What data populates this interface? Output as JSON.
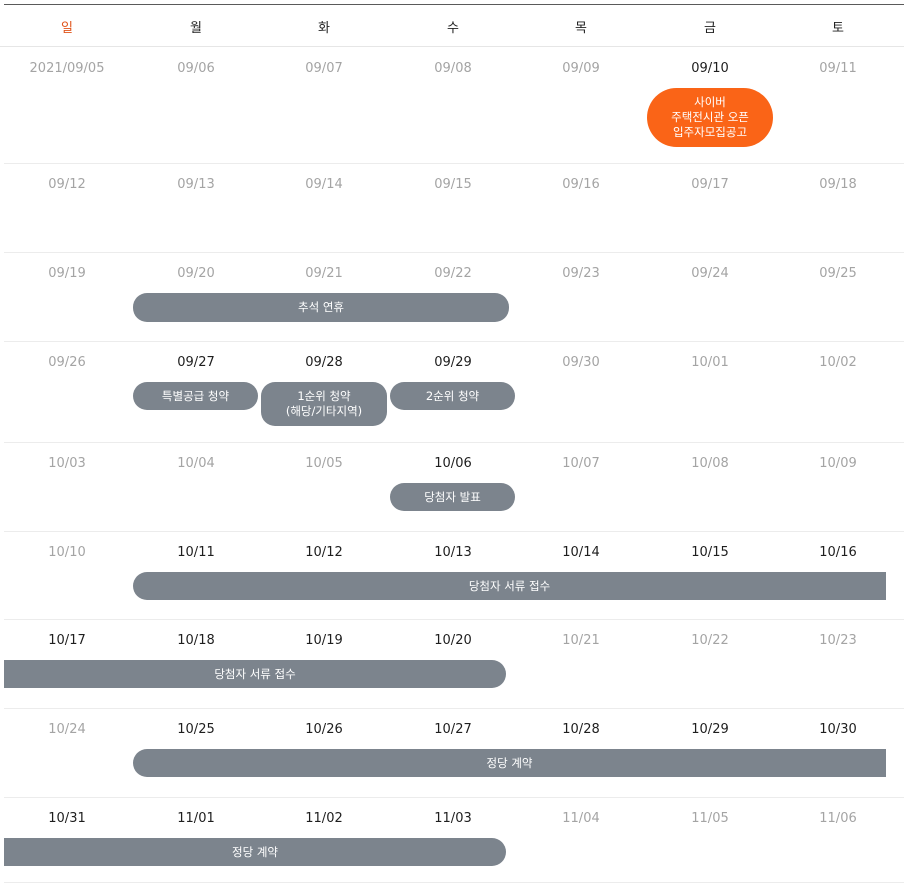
{
  "calendar": {
    "weekdays": [
      "일",
      "월",
      "화",
      "수",
      "목",
      "금",
      "토"
    ],
    "weeks": [
      {
        "dates": [
          "2021/09/05",
          "09/06",
          "09/07",
          "09/08",
          "09/09",
          "09/10",
          "09/11"
        ],
        "active": [
          false,
          false,
          false,
          false,
          false,
          true,
          false
        ],
        "events": [
          {
            "label": "사이버\n주택전시관 오픈\n입주자모집공고",
            "color": "orange"
          }
        ]
      },
      {
        "dates": [
          "09/12",
          "09/13",
          "09/14",
          "09/15",
          "09/16",
          "09/17",
          "09/18"
        ],
        "active": [
          false,
          false,
          false,
          false,
          false,
          false,
          false
        ],
        "events": []
      },
      {
        "dates": [
          "09/19",
          "09/20",
          "09/21",
          "09/22",
          "09/23",
          "09/24",
          "09/25"
        ],
        "active": [
          false,
          false,
          false,
          false,
          false,
          false,
          false
        ],
        "events": [
          {
            "label": "추석 연휴"
          }
        ]
      },
      {
        "dates": [
          "09/26",
          "09/27",
          "09/28",
          "09/29",
          "09/30",
          "10/01",
          "10/02"
        ],
        "active": [
          false,
          true,
          true,
          true,
          false,
          false,
          false
        ],
        "events": [
          {
            "label": "특별공급 청약"
          },
          {
            "label": "1순위 청약\n(해당/기타지역)"
          },
          {
            "label": "2순위 청약"
          }
        ]
      },
      {
        "dates": [
          "10/03",
          "10/04",
          "10/05",
          "10/06",
          "10/07",
          "10/08",
          "10/09"
        ],
        "active": [
          false,
          false,
          false,
          true,
          false,
          false,
          false
        ],
        "events": [
          {
            "label": "당첨자 발표"
          }
        ]
      },
      {
        "dates": [
          "10/10",
          "10/11",
          "10/12",
          "10/13",
          "10/14",
          "10/15",
          "10/16"
        ],
        "active": [
          false,
          true,
          true,
          true,
          true,
          true,
          true
        ],
        "events": [
          {
            "label": "당첨자 서류 접수"
          }
        ]
      },
      {
        "dates": [
          "10/17",
          "10/18",
          "10/19",
          "10/20",
          "10/21",
          "10/22",
          "10/23"
        ],
        "active": [
          true,
          true,
          true,
          true,
          false,
          false,
          false
        ],
        "events": [
          {
            "label": "당첨자 서류 접수"
          }
        ]
      },
      {
        "dates": [
          "10/24",
          "10/25",
          "10/26",
          "10/27",
          "10/28",
          "10/29",
          "10/30"
        ],
        "active": [
          false,
          true,
          true,
          true,
          true,
          true,
          true
        ],
        "events": [
          {
            "label": "정당 계약"
          }
        ]
      },
      {
        "dates": [
          "10/31",
          "11/01",
          "11/02",
          "11/03",
          "11/04",
          "11/05",
          "11/06"
        ],
        "active": [
          true,
          true,
          true,
          true,
          false,
          false,
          false
        ],
        "events": [
          {
            "label": "정당 계약"
          }
        ]
      }
    ]
  }
}
